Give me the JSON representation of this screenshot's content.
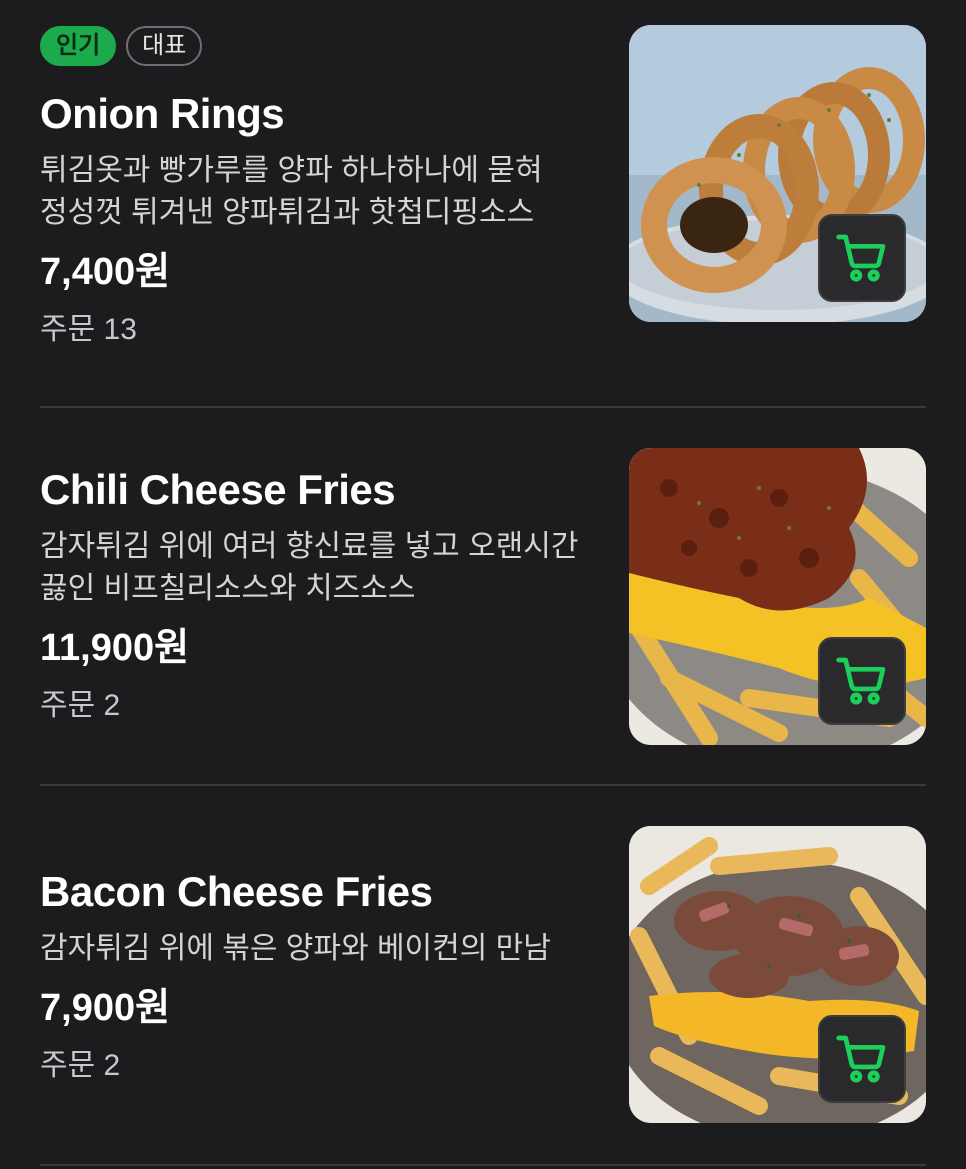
{
  "menu": {
    "items": [
      {
        "badges": [
          {
            "label": "인기",
            "type": "popular"
          },
          {
            "label": "대표",
            "type": "signature"
          }
        ],
        "name": "Onion Rings",
        "description": "튀김옷과 빵가루를 양파 하나하나에 묻혀 정성껏 튀겨낸 양파튀김과 핫첩디핑소스",
        "price": "7,400원",
        "orders": "주문 13",
        "image_icon": "onion-rings-photo",
        "cart_icon": "cart-icon"
      },
      {
        "name": "Chili Cheese Fries",
        "description": "감자튀김 위에 여러 향신료를 넣고 오랜시간 끓인 비프칠리소스와 치즈소스",
        "price": "11,900원",
        "orders": "주문 2",
        "image_icon": "chili-cheese-fries-photo",
        "cart_icon": "cart-icon"
      },
      {
        "name": "Bacon Cheese Fries",
        "description": "감자튀김 위에 볶은 양파와 베이컨의 만남",
        "price": "7,900원",
        "orders": "주문 2",
        "image_icon": "bacon-cheese-fries-photo",
        "cart_icon": "cart-icon"
      }
    ]
  },
  "colors": {
    "background": "#1c1c1e",
    "accent": "#1bab4c",
    "divider": "#3a3a3c"
  }
}
